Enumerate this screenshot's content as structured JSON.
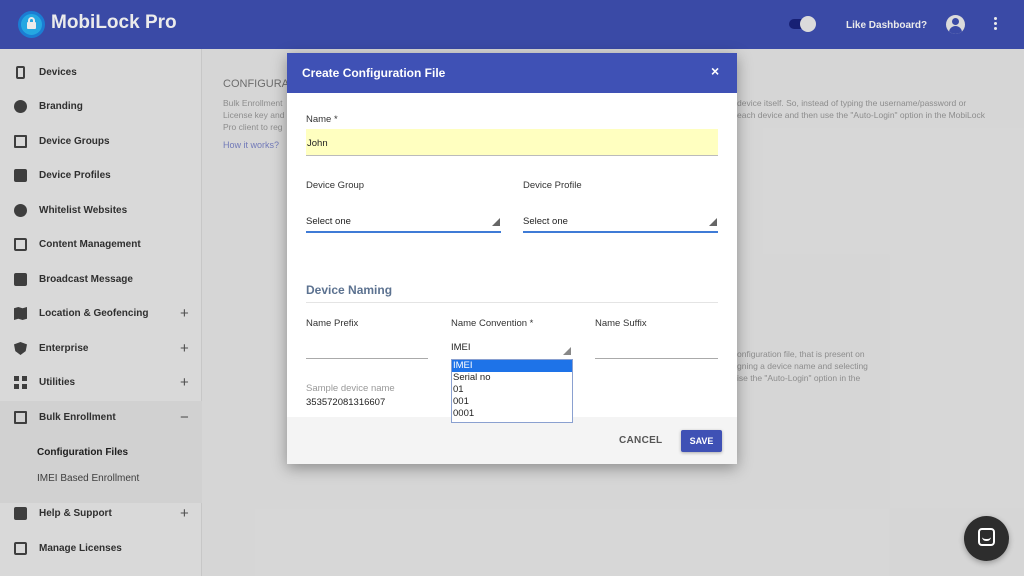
{
  "app": {
    "title": "MobiLock Pro"
  },
  "topbar": {
    "like_dashboard": "Like Dashboard?"
  },
  "sidebar": {
    "items": [
      {
        "label": "Devices",
        "icon": "phone-icon"
      },
      {
        "label": "Branding",
        "icon": "palette-icon"
      },
      {
        "label": "Device Groups",
        "icon": "devices-icon"
      },
      {
        "label": "Device Profiles",
        "icon": "profile-icon"
      },
      {
        "label": "Whitelist Websites",
        "icon": "globe-icon"
      },
      {
        "label": "Content Management",
        "icon": "folder-icon"
      },
      {
        "label": "Broadcast Message",
        "icon": "chat-icon"
      },
      {
        "label": "Location & Geofencing",
        "icon": "map-icon",
        "expander": "+"
      },
      {
        "label": "Enterprise",
        "icon": "shield-icon",
        "expander": "+"
      },
      {
        "label": "Utilities",
        "icon": "apps-icon",
        "expander": "+"
      },
      {
        "label": "Bulk Enrollment",
        "icon": "enroll-icon",
        "expander": "−"
      },
      {
        "label": "Help & Support",
        "icon": "help-icon",
        "expander": "+"
      },
      {
        "label": "Manage Licenses",
        "icon": "license-icon"
      }
    ],
    "bulk_sub": [
      {
        "label": "Configuration Files"
      },
      {
        "label": "IMEI Based Enrollment"
      }
    ]
  },
  "background": {
    "title": "CONFIGURAT",
    "text_left": [
      "Bulk Enrollment",
      "License key and",
      "Pro client to reg"
    ],
    "text_right": [
      "device itself. So, instead of typing the username/password or",
      "each device and then use the \"Auto-Login\" option in the MobiLock"
    ],
    "link": "How it works?",
    "text_lower": [
      "onfiguration file, that is present on",
      "gning a device name and selecting",
      "ise the \"Auto-Login\" option in the"
    ]
  },
  "dialog": {
    "title": "Create Configuration File",
    "close": "×",
    "name_label": "Name *",
    "name_value": "John",
    "device_group_label": "Device Group",
    "device_group_value": "Select one",
    "device_profile_label": "Device Profile",
    "device_profile_value": "Select one",
    "section_title": "Device Naming",
    "prefix_label": "Name Prefix",
    "convention_label": "Name Convention *",
    "convention_value": "IMEI",
    "suffix_label": "Name Suffix",
    "convention_options": [
      "IMEI",
      "Serial no",
      "01",
      "001",
      "0001"
    ],
    "sample_label": "Sample device name",
    "sample_value": "353572081316607",
    "cancel_label": "CANCEL",
    "save_label": "SAVE"
  },
  "colors": {
    "primary": "#3f51b5",
    "highlight": "#ffffc0",
    "select_blue": "#1e73e8"
  }
}
